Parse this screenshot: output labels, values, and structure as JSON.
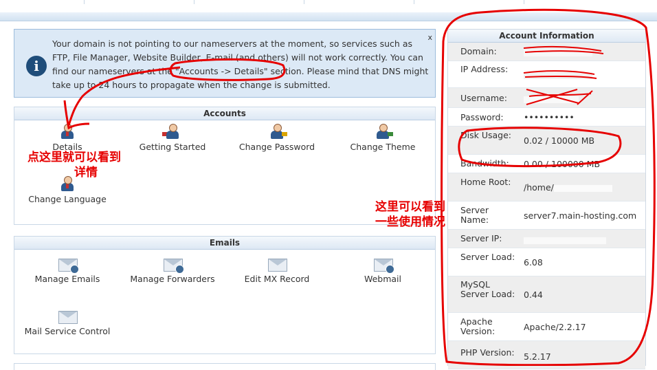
{
  "notice": {
    "message": "Your domain is not pointing to our nameservers at the moment, so services such as FTP, File Manager, Website Builder, E-mail (and others) will not work correctly. You can find our nameservers at the \"Accounts -> Details\" section. Please mind that DNS might take up to 24 hours to propagate when the change is submitted.",
    "close": "x"
  },
  "accounts": {
    "title": "Accounts",
    "items": [
      {
        "label": "Details"
      },
      {
        "label": "Getting Started"
      },
      {
        "label": "Change Password"
      },
      {
        "label": "Change Theme"
      },
      {
        "label": "Change Language"
      }
    ]
  },
  "emails": {
    "title": "Emails",
    "items": [
      {
        "label": "Manage Emails"
      },
      {
        "label": "Manage Forwarders"
      },
      {
        "label": "Edit MX Record"
      },
      {
        "label": "Webmail"
      },
      {
        "label": "Mail Service Control"
      }
    ]
  },
  "account_info": {
    "title": "Account Information",
    "rows": [
      {
        "label": "Domain:",
        "value": ""
      },
      {
        "label": "IP Address:",
        "value": ""
      },
      {
        "label": "Username:",
        "value": ""
      },
      {
        "label": "Password:",
        "value": "••••••••••"
      },
      {
        "label": "Disk Usage:",
        "value": "0.02 / 10000 MB"
      },
      {
        "label": "Bandwidth:",
        "value": "0.00 / 100000 MB"
      },
      {
        "label": "Home Root:",
        "value": "/home/"
      },
      {
        "label": "Server Name:",
        "value": "server7.main-hosting.com"
      },
      {
        "label": "Server IP:",
        "value": ""
      },
      {
        "label": "Server Load:",
        "value": "6.08"
      },
      {
        "label": "MySQL Server Load:",
        "value": "0.44"
      },
      {
        "label": "Apache Version:",
        "value": "Apache/2.2.17"
      },
      {
        "label": "PHP Version:",
        "value": "5.2.17"
      }
    ]
  },
  "annotations": {
    "left_line1": "点这里就可以看到",
    "left_line2": "详情",
    "right_line1": "这里可以看到",
    "right_line2": "一些使用情况"
  },
  "colors": {
    "annotation": "#e60000",
    "notice_bg": "#dce9f6",
    "panel_header": "#dde8f4"
  }
}
